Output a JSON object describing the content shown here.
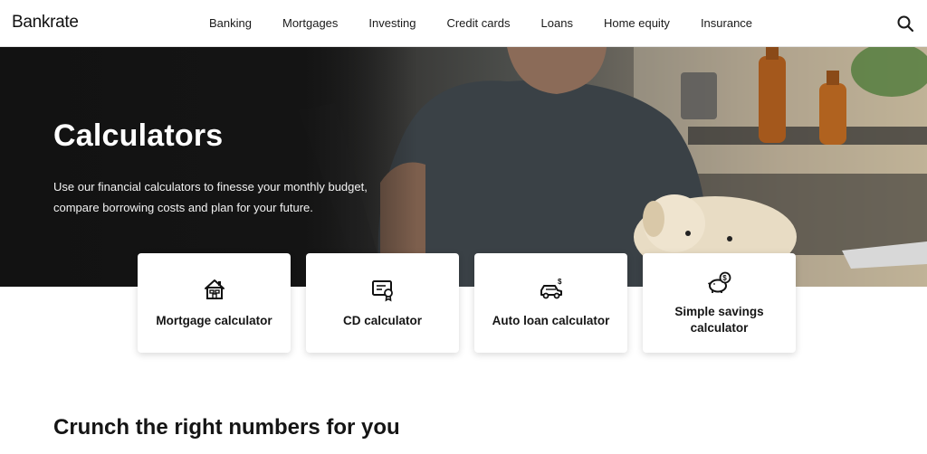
{
  "brand": {
    "logo_text": "Bankrate"
  },
  "nav": {
    "items": [
      "Banking",
      "Mortgages",
      "Investing",
      "Credit cards",
      "Loans",
      "Home equity",
      "Insurance"
    ],
    "search_icon": "search-icon"
  },
  "hero": {
    "title": "Calculators",
    "subtitle_line1": "Use our financial calculators to finesse your monthly budget,",
    "subtitle_line2": "compare borrowing costs and plan for your future."
  },
  "cards": [
    {
      "label": "Mortgage calculator",
      "icon": "house-icon"
    },
    {
      "label": "CD calculator",
      "icon": "certificate-icon"
    },
    {
      "label": "Auto loan calculator",
      "icon": "car-dollar-icon"
    },
    {
      "label_line1": "Simple savings",
      "label_line2": "calculator",
      "icon": "piggy-bank-icon"
    }
  ],
  "section": {
    "title": "Crunch the right numbers for you"
  },
  "colors": {
    "text": "#151515",
    "hero_dark": "#141414",
    "card_bg": "#ffffff"
  }
}
